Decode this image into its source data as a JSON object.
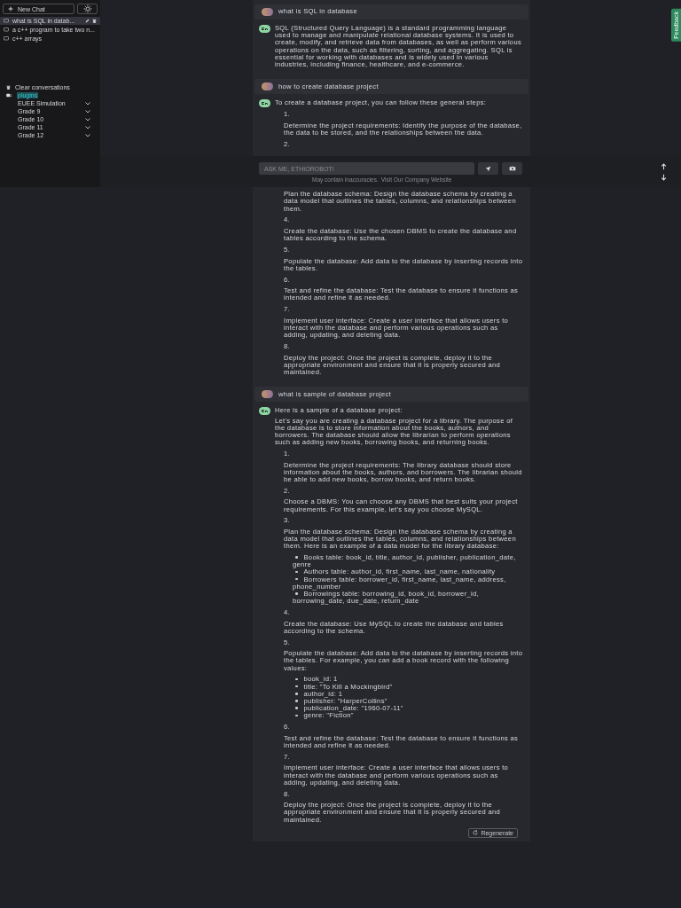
{
  "sidebar": {
    "new_chat": "New Chat",
    "conversations": [
      {
        "title": "what is SQL in datab...",
        "selected": true
      },
      {
        "title": "a c++ program to take two n...",
        "selected": false
      },
      {
        "title": "c++ arrays",
        "selected": false
      }
    ],
    "clear_conversations": "Clear conversations",
    "plugins": {
      "label": "plugins",
      "expanded": true,
      "items": [
        "EUEE Simulation",
        "Grade 9",
        "Grade 10",
        "Grade 11",
        "Grade 12"
      ]
    }
  },
  "messages": [
    {
      "kind": "user",
      "text": "what is SQL in database"
    },
    {
      "kind": "assistant",
      "blocks": [
        {
          "kind": "paragraph",
          "text": "SQL (Structured Query Language) is a standard programming language used to manage and manipulate relational database systems. It is used to create, modify, and retrieve data from databases, as well as perform various operations on the data, such as filtering, sorting, and aggregating. SQL is essential for working with databases and is widely used in various industries, including finance, healthcare, and e-commerce."
        }
      ]
    },
    {
      "kind": "user",
      "text": "how to create database project"
    },
    {
      "kind": "assistant",
      "blocks": [
        {
          "kind": "paragraph",
          "text": "To create a database project, you can follow these general steps:"
        },
        {
          "kind": "step",
          "number": "1.",
          "text": "Determine the project requirements: Identify the purpose of the database, the data to be stored, and the relationships between the data."
        },
        {
          "kind": "step",
          "number": "2."
        },
        {
          "kind": "step",
          "text": "Plan the database schema: Design the database schema by creating a data model that outlines the tables, columns, and relationships between them."
        },
        {
          "kind": "step",
          "number": "4.",
          "text": "Create the database: Use the chosen DBMS to create the database and tables according to the schema."
        },
        {
          "kind": "step",
          "number": "5.",
          "text": "Populate the database: Add data to the database by inserting records into the tables."
        },
        {
          "kind": "step",
          "number": "6.",
          "text": "Test and refine the database: Test the database to ensure it functions as intended and refine it as needed."
        },
        {
          "kind": "step",
          "number": "7.",
          "text": "Implement user interface: Create a user interface that allows users to interact with the database and perform various operations such as adding, updating, and deleting data."
        },
        {
          "kind": "step",
          "number": "8.",
          "text": "Deploy the project: Once the project is complete, deploy it to the appropriate environment and ensure that it is properly secured and maintained."
        }
      ]
    },
    {
      "kind": "user",
      "text": "what is sample of database project"
    },
    {
      "kind": "assistant",
      "blocks": [
        {
          "kind": "paragraph",
          "text": "Here is a sample of a database project:"
        },
        {
          "kind": "paragraph",
          "text": "Let's say you are creating a database project for a library. The purpose of the database is to store information about the books, authors, and borrowers. The database should allow the librarian to perform operations such as adding new books, borrowing books, and returning books."
        },
        {
          "kind": "step",
          "number": "1.",
          "text": "Determine the project requirements: The library database should store information about the books, authors, and borrowers. The librarian should be able to add new books, borrow books, and return books."
        },
        {
          "kind": "step",
          "number": "2.",
          "text": "Choose a DBMS: You can choose any DBMS that best suits your project requirements. For this example, let's say you choose MySQL."
        },
        {
          "kind": "step",
          "number": "3.",
          "text": "Plan the database schema: Design the database schema by creating a data model that outlines the tables, columns, and relationships between them. Here is an example of a data model for the library database:"
        },
        {
          "kind": "bullets",
          "items": [
            "Books table: book_id, title, author_id, publisher, publication_date, genre",
            "Authors table: author_id, first_name, last_name, nationality",
            "Borrowers table: borrower_id, first_name, last_name, address, phone_number",
            "Borrowings table: borrowing_id, book_id, borrower_id, borrowing_date, due_date, return_date"
          ]
        },
        {
          "kind": "step",
          "number": "4.",
          "text": "Create the database: Use MySQL to create the database and tables according to the schema."
        },
        {
          "kind": "step",
          "number": "5.",
          "text": "Populate the database: Add data to the database by inserting records into the tables. For example, you can add a book record with the following values:"
        },
        {
          "kind": "bullets",
          "items": [
            "book_id: 1",
            "title: \"To Kill a Mockingbird\"",
            "author_id: 1",
            "publisher: \"HarperCollins\"",
            "publication_date: \"1960-07-11\"",
            "genre: \"Fiction\""
          ]
        },
        {
          "kind": "step",
          "number": "6.",
          "text": "Test and refine the database: Test the database to ensure it functions as intended and refine it as needed."
        },
        {
          "kind": "step",
          "number": "7.",
          "text": "Implement user interface: Create a user interface that allows users to interact with the database and perform various operations such as adding, updating, and deleting data."
        },
        {
          "kind": "step",
          "number": "8.",
          "text": "Deploy the project: Once the project is complete, deploy it to the appropriate environment and ensure that it is properly secured and maintained."
        }
      ]
    }
  ],
  "regenerate_button": "Regenerate",
  "input": {
    "placeholder": "ASK ME, ETHIOROBOT!"
  },
  "disclaimer": {
    "text": "May contain inaccuracies.",
    "link": "Visit Our Company Website"
  },
  "feedback_tab": "Feedback"
}
